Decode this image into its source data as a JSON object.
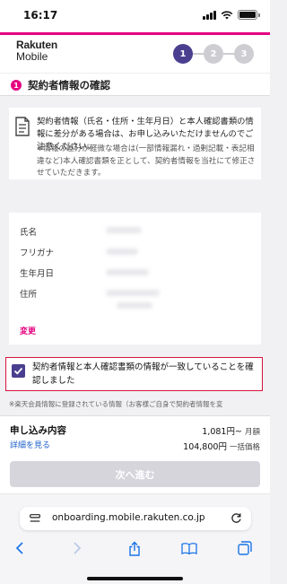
{
  "status_bar": {
    "time": "16:17"
  },
  "header": {
    "logo_line1": "Rakuten",
    "logo_line2": "Mobile",
    "steps": [
      "1",
      "2",
      "3"
    ],
    "active_step": 1,
    "accent_color": "#e4007f",
    "step_active_color": "#4a3f8f"
  },
  "section": {
    "number": "1",
    "title": "契約者情報の確認"
  },
  "notice": {
    "main": "契約者情報（氏名・住所・生年月日）と本人確認書類の情報に差分がある場合は、お申し込みいただけませんのでご注意ください。",
    "sub": "※情報の差分が軽微な場合は(一部情報漏れ・過剰記載・表記相違など)本人確認書類を正として、契約者情報を当社にて修正させていただきます。"
  },
  "info_card": {
    "rows": [
      {
        "label": "氏名"
      },
      {
        "label": "フリガナ"
      },
      {
        "label": "生年月日"
      },
      {
        "label": "住所"
      }
    ],
    "change_label": "変更"
  },
  "confirm": {
    "checked": true,
    "text": "契約者情報と本人確認書類の情報が一致していることを確認しました"
  },
  "note": "※楽天会員情報に登録されている情報（お客様ご自身で契約者情報を変",
  "summary": {
    "title": "申し込み内容",
    "details_link": "詳細を見る",
    "monthly_price": "1,081円~",
    "monthly_unit": "月額",
    "onetime_price": "104,800円",
    "onetime_unit": "一括価格",
    "next_button": "次へ進む"
  },
  "browser": {
    "url": "onboarding.mobile.rakuten.co.jp",
    "icons": [
      "page-settings-icon",
      "reload-icon",
      "back-icon",
      "forward-icon",
      "share-icon",
      "bookmarks-icon",
      "tabs-icon"
    ]
  }
}
